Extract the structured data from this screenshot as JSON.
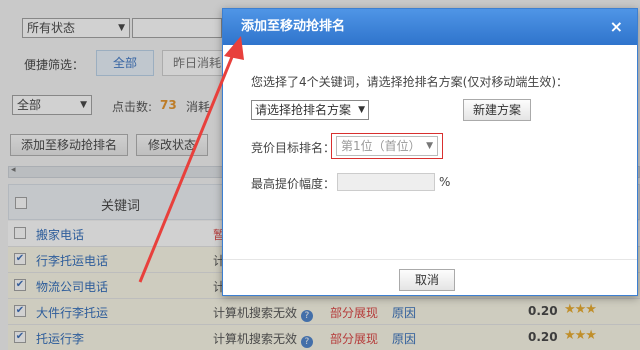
{
  "filters": {
    "status_select": "所有状态",
    "quick_filter_label": "便捷筛选：",
    "tab_all": "全部",
    "tab_yesterday": "昨日消耗",
    "scope_select": "全部",
    "clicks_label": "点击数:",
    "clicks_value": "73",
    "cost_label": "消耗"
  },
  "toolbar": {
    "add_button": "添加至移动抢排名",
    "modify_status_button": "修改状态"
  },
  "table": {
    "header_keyword": "关键词",
    "rows": [
      {
        "keyword": "搬家电话",
        "checked": false,
        "mid": "",
        "warn": "暂",
        "reason": "",
        "price": "",
        "stars": ""
      },
      {
        "keyword": "行李托运电话",
        "checked": true,
        "mid": "计",
        "warn": "",
        "reason": "",
        "price": "",
        "stars": ""
      },
      {
        "keyword": "物流公司电话",
        "checked": true,
        "mid": "计",
        "warn": "",
        "reason": "",
        "price": "",
        "stars": ""
      },
      {
        "keyword": "大件行李托运",
        "checked": true,
        "mid": "计算机搜索无效",
        "warn": "部分展现",
        "reason": "原因",
        "price": "0.20",
        "stars": "★★★"
      },
      {
        "keyword": "托运行李",
        "checked": true,
        "mid": "计算机搜索无效",
        "warn": "部分展现",
        "reason": "原因",
        "price": "0.20",
        "stars": "★★★"
      }
    ]
  },
  "modal": {
    "title": "添加至移动抢排名",
    "close": "×",
    "description": "您选择了4个关键词，请选择抢排名方案(仅对移动端生效)：",
    "plan_select": "请选择抢排名方案",
    "new_plan_button": "新建方案",
    "target_rank_label": "竞价目标排名：",
    "target_rank_value": "第1位（首位）",
    "max_bid_label": "最高提价幅度：",
    "percent": "%",
    "cancel_button": "取消"
  },
  "colors": {
    "accent": "#2f74cc",
    "annotation": "#e8403c"
  }
}
